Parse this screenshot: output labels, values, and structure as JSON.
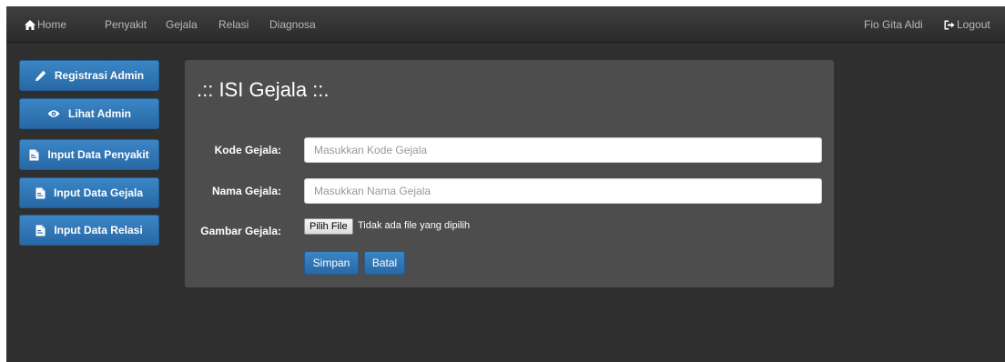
{
  "navbar": {
    "home_label": "Home",
    "items": [
      "Penyakit",
      "Gejala",
      "Relasi",
      "Diagnosa"
    ],
    "user_name": "Fio Gita Aldi",
    "logout_label": "Logout"
  },
  "sidebar": {
    "items": [
      {
        "label": "Registrasi Admin",
        "icon": "pencil-icon"
      },
      {
        "label": "Lihat Admin",
        "icon": "eye-icon"
      },
      {
        "label": "Input Data Penyakit",
        "icon": "file-icon"
      },
      {
        "label": "Input Data Gejala",
        "icon": "file-icon"
      },
      {
        "label": "Input Data Relasi",
        "icon": "file-icon"
      }
    ]
  },
  "form": {
    "title": ".:: ISI Gejala ::.",
    "kode_label": "Kode Gejala:",
    "kode_placeholder": "Masukkan Kode Gejala",
    "nama_label": "Nama Gejala:",
    "nama_placeholder": "Masukkan Nama Gejala",
    "gambar_label": "Gambar Gejala:",
    "file_button": "Pilih File",
    "file_status": "Tidak ada file yang dipilih",
    "save_label": "Simpan",
    "cancel_label": "Batal"
  },
  "colors": {
    "background": "#2f2f2f",
    "navbar": "#363636",
    "panel": "#4d4d4d",
    "primary_button": "#2f77b8"
  }
}
